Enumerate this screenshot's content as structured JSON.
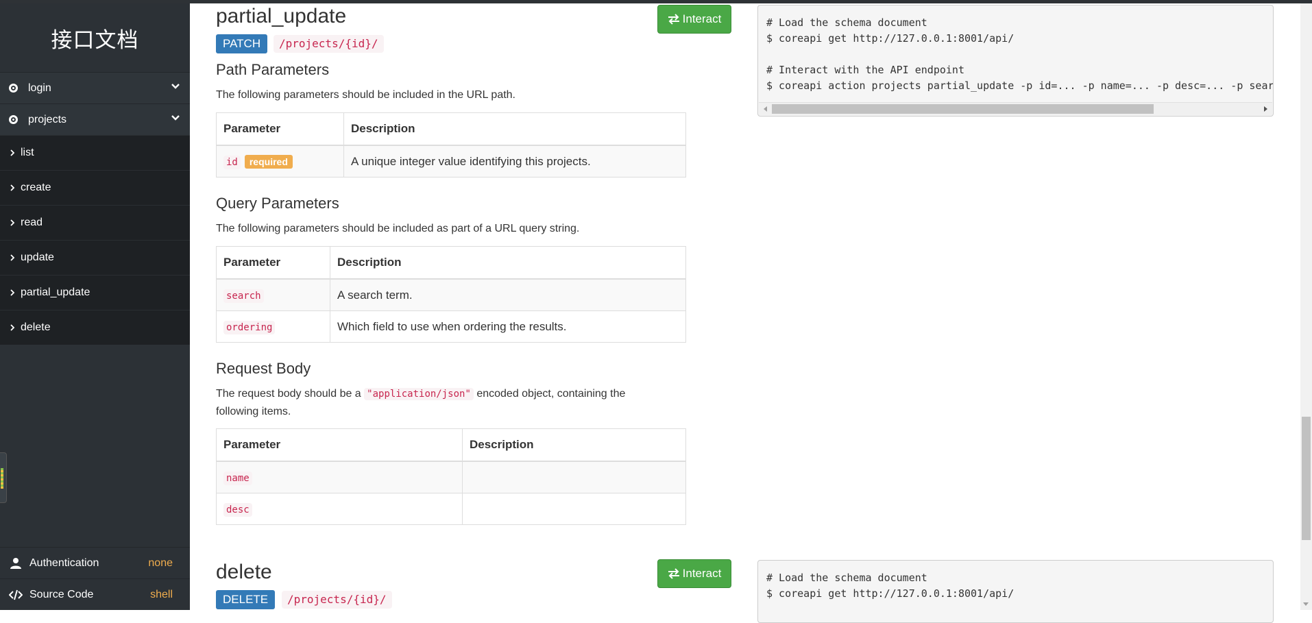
{
  "sidebar": {
    "brand": "接口文档",
    "sections": [
      {
        "label": "login"
      },
      {
        "label": "projects"
      }
    ],
    "sub_items": [
      "list",
      "create",
      "read",
      "update",
      "partial_update",
      "delete"
    ],
    "footer": {
      "auth_label": "Authentication",
      "auth_value": "none",
      "source_label": "Source Code",
      "source_value": "shell"
    }
  },
  "partial_update": {
    "title": "partial_update",
    "method": "PATCH",
    "path": "/projects/{id}/",
    "interact_label": "Interact",
    "path_params": {
      "heading": "Path Parameters",
      "description": "The following parameters should be included in the URL path.",
      "col_param": "Parameter",
      "col_desc": "Description",
      "rows": [
        {
          "name": "id",
          "badge": "required",
          "description": "A unique integer value identifying this projects."
        }
      ]
    },
    "query_params": {
      "heading": "Query Parameters",
      "description": "The following parameters should be included as part of a URL query string.",
      "col_param": "Parameter",
      "col_desc": "Description",
      "rows": [
        {
          "name": "search",
          "description": "A search term."
        },
        {
          "name": "ordering",
          "description": "Which field to use when ordering the results."
        }
      ]
    },
    "request_body": {
      "heading": "Request Body",
      "desc_before": "The request body should be a ",
      "desc_code": "\"application/json\"",
      "desc_after": " encoded object, containing the following items.",
      "col_param": "Parameter",
      "col_desc": "Description",
      "rows": [
        {
          "name": "name",
          "description": ""
        },
        {
          "name": "desc",
          "description": ""
        }
      ]
    },
    "code_lines": [
      "# Load the schema document",
      "$ coreapi get http://127.0.0.1:8001/api/",
      "",
      "# Interact with the API endpoint",
      "$ coreapi action projects partial_update -p id=... -p name=... -p desc=... -p searc"
    ]
  },
  "delete": {
    "title": "delete",
    "method": "DELETE",
    "path": "/projects/{id}/",
    "interact_label": "Interact",
    "code_lines": [
      "# Load the schema document",
      "$ coreapi get http://127.0.0.1:8001/api/"
    ]
  },
  "colors": {
    "sidebar_bg": "#2c3136",
    "submenu_bg": "#1e2124",
    "method_patch": "#337ab7",
    "method_delete": "#337ab7",
    "interact_green": "#4aa846",
    "required_badge": "#f0ad4e",
    "code_red": "#c7254e"
  },
  "icons": {
    "section": "radio-dot-icon",
    "expand": "chevron-down-icon",
    "sub_item": "chevron-right-icon",
    "auth": "user-icon",
    "source": "code-icon",
    "interact": "exchange-arrows-icon"
  }
}
